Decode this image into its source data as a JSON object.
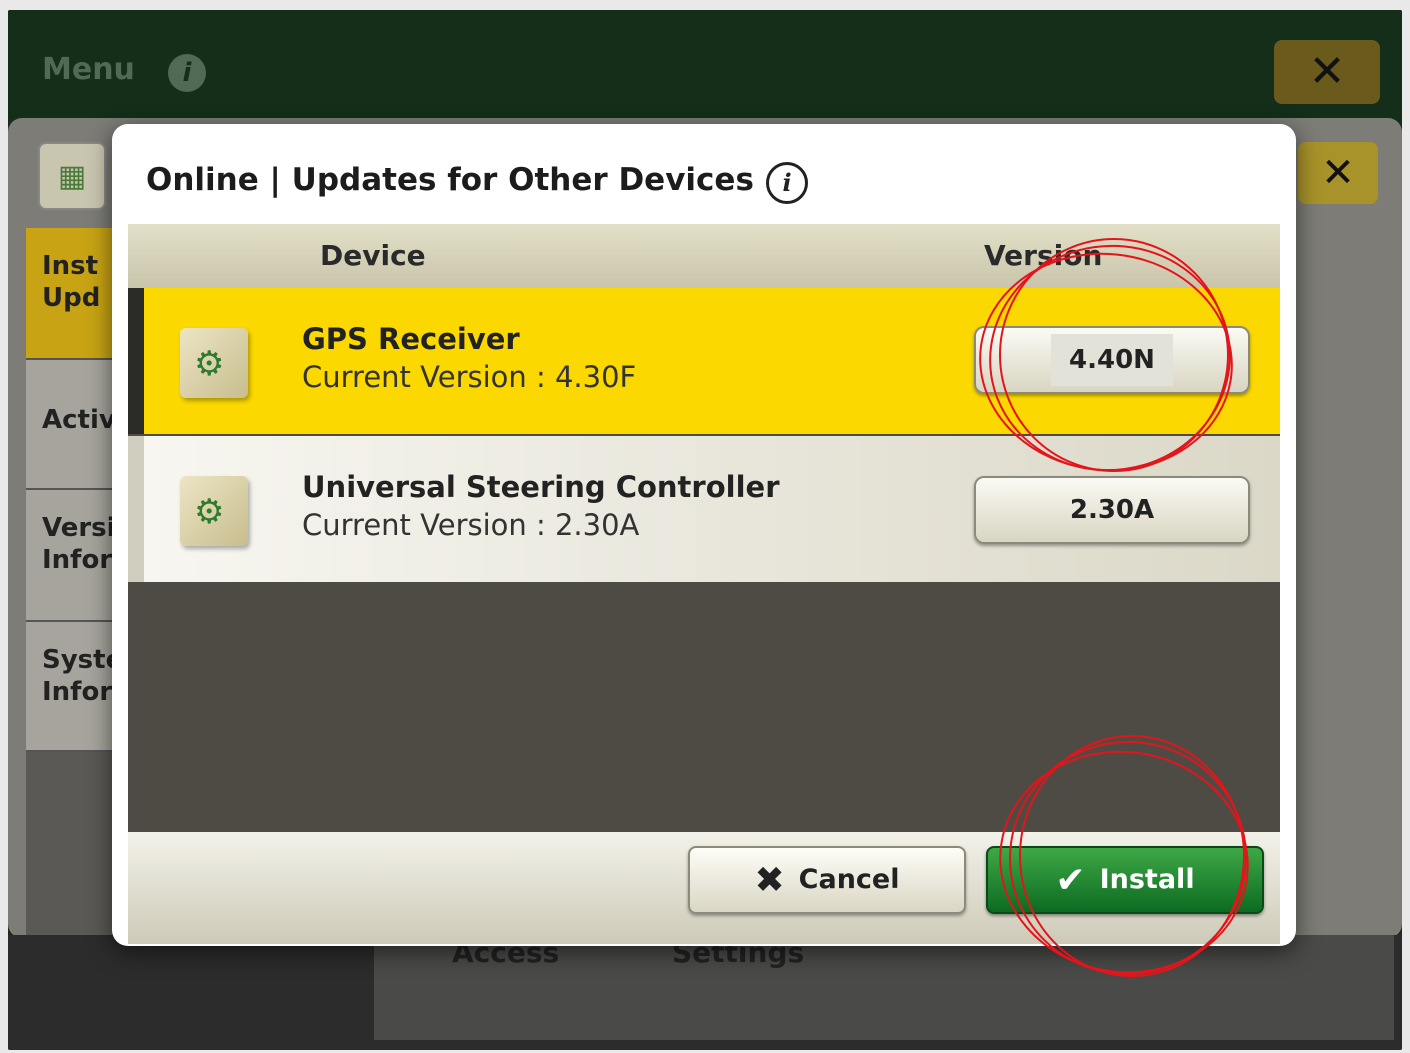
{
  "background_window": {
    "title": "Menu",
    "bottom_labels": [
      "Access",
      "Settings"
    ],
    "sidebar": [
      {
        "label_line1": "Inst",
        "label_line2": "Upd"
      },
      {
        "label_line1": "Activ",
        "label_line2": ""
      },
      {
        "label_line1": "Versi",
        "label_line2": "Infor"
      },
      {
        "label_line1": "Syste",
        "label_line2": "Infor"
      }
    ]
  },
  "dialog": {
    "title": "Online | Updates for Other Devices",
    "columns": {
      "device": "Device",
      "version": "Version"
    },
    "rows": [
      {
        "name": "GPS Receiver",
        "current": "Current Version : 4.30F",
        "version": "4.40N",
        "selected": true
      },
      {
        "name": "Universal Steering Controller",
        "current": "Current Version : 2.30A",
        "version": "2.30A",
        "selected": false
      }
    ],
    "cancel_label": "Cancel",
    "install_label": "Install"
  },
  "colors": {
    "selected_row": "#fbd800",
    "install_button": "#1f8a2e",
    "annotation": "#e4141b"
  }
}
